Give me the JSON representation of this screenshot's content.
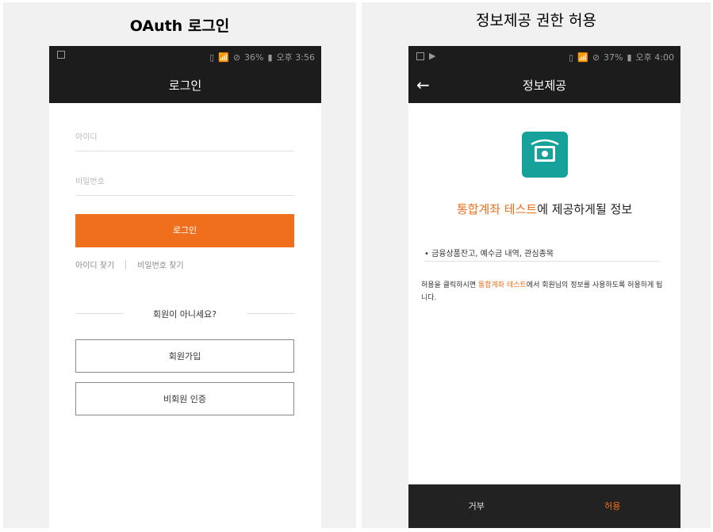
{
  "left_panel": {
    "title": "OAuth 로그인",
    "status": {
      "time": "오후 3:56",
      "battery": "36%"
    },
    "appbar_title": "로그인",
    "id_placeholder": "아이디",
    "pw_placeholder": "비밀번호",
    "login_label": "로그인",
    "find_id": "아이디 찾기",
    "find_pw": "비밀번호 찾기",
    "not_member": "회원이 아니세요?",
    "signup_label": "회원가입",
    "guest_label": "비회원 인증"
  },
  "right_panel": {
    "title": "정보제공 권한 허용",
    "status": {
      "time": "오후 4:00",
      "battery": "37%"
    },
    "appbar_title": "정보제공",
    "consent_app": "통합계좌 테스트",
    "consent_suffix": "에 제공하게될 정보",
    "scope_item": "• 금융상품잔고, 예수금 내역, 관심종목",
    "notice_prefix": "허용을 클릭하시면 ",
    "notice_app": "통합계좌 테스트",
    "notice_suffix": "에서 회원님의 정보를 사용하도록 허용하게 됩니다.",
    "deny_label": "거부",
    "allow_label": "허용"
  },
  "colors": {
    "accent": "#ef6f1c",
    "bar": "#1c1c1c",
    "icon_bg": "#16a29a"
  }
}
